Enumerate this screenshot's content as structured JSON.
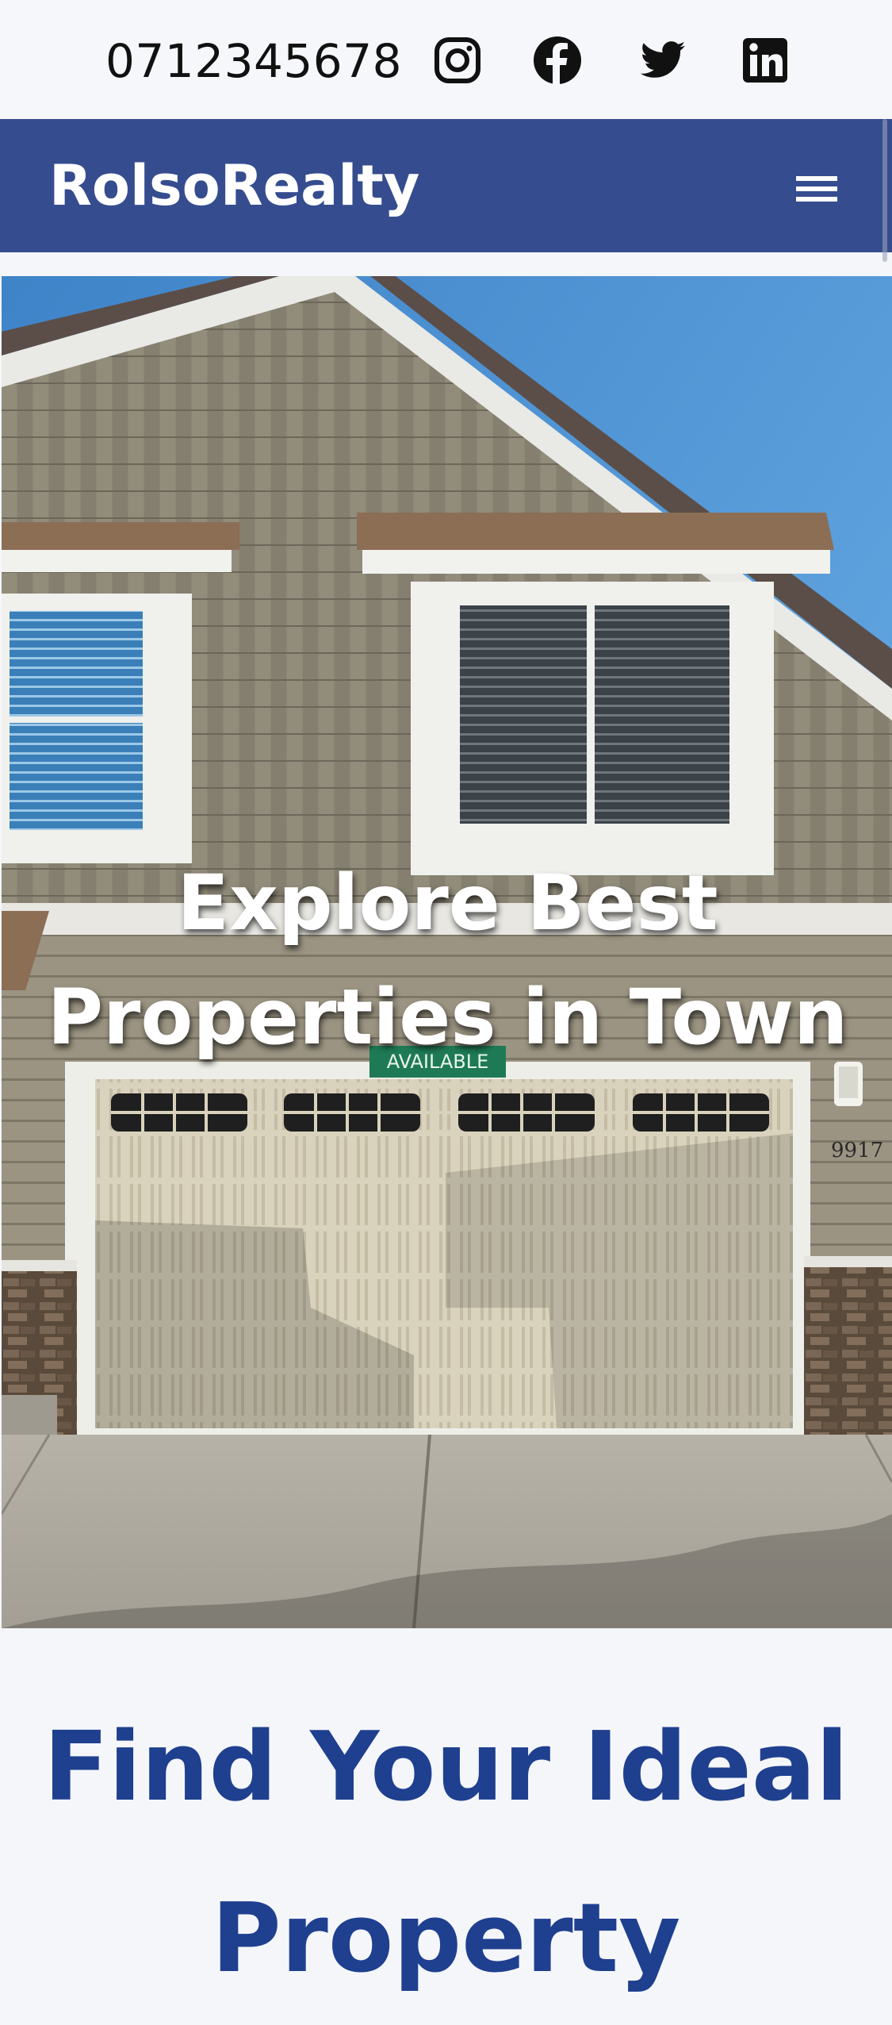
{
  "topbar": {
    "phone": "0712345678",
    "social_icons": [
      "instagram-icon",
      "facebook-icon",
      "twitter-icon",
      "linkedin-icon"
    ]
  },
  "navbar": {
    "brand": "RolsoRealty",
    "menu_icon": "hamburger-menu-icon",
    "background": "#354c8f"
  },
  "hero": {
    "title_line_1": "Explore Best",
    "title_line_2": "Properties in Town",
    "sign_text": "AVAILABLE",
    "house_number": "9917"
  },
  "section": {
    "title_line_1": "Find Your Ideal",
    "title_line_2": "Property",
    "title_color": "#1f3f8f"
  }
}
